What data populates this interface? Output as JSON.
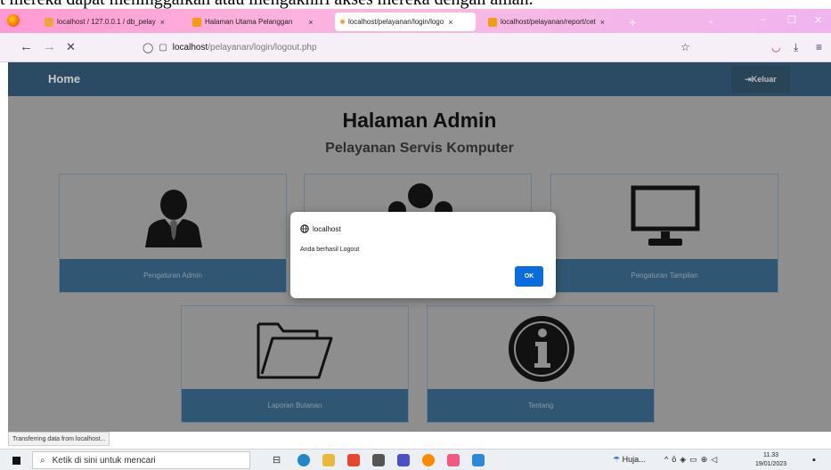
{
  "caption_text": "t mereka dapat meninggalkan atau mengakhiri akses mereka dengan aman.",
  "tabs": [
    {
      "label": "localhost / 127.0.0.1 / db_pelay",
      "active": false,
      "fav_color": "#f0a33a"
    },
    {
      "label": "Halaman Utama Pelanggan",
      "active": false,
      "fav_color": "#f39c12"
    },
    {
      "label": "localhost/pelayanan/login/logo",
      "active": true,
      "fav_color": "#f0a33a"
    },
    {
      "label": "localhost/pelayanan/report/cet",
      "active": false,
      "fav_color": "#f39c12"
    }
  ],
  "tab_close": "×",
  "new_tab": "+",
  "tab_menu": "⌄",
  "window_controls": {
    "minimize": "–",
    "restore": "❐",
    "close": "✕"
  },
  "nav": {
    "back": "←",
    "forward": "→",
    "stop": "✕",
    "url_host": "localhost",
    "url_path": "/pelayanan/login/logout.php",
    "bookmark_icon": "☆",
    "pocket_icon": "◡",
    "download_icon": "⤓",
    "menu_icon": "≡"
  },
  "site": {
    "home_label": "Home",
    "logout_label": "⇥Keluar",
    "title": "Halaman Admin",
    "subtitle": "Pelayanan Servis Komputer",
    "cards": [
      {
        "label": "Pengaturan Admin",
        "icon": "admin-user-icon"
      },
      {
        "label": "",
        "icon": "users-group-icon"
      },
      {
        "label": "Pengaturan Tampilan",
        "icon": "monitor-icon"
      },
      {
        "label": "Laporan Bulanan",
        "icon": "folder-icon"
      },
      {
        "label": "Tentang",
        "icon": "info-icon"
      }
    ]
  },
  "dialog": {
    "origin": "localhost",
    "message": "Anda berhasil Logout",
    "ok_label": "OK"
  },
  "status_text": "Transferring data from localhost...",
  "taskbar": {
    "search_placeholder": "Ketik di sini untuk mencari",
    "weather": "Huja...",
    "time": "11.33",
    "date": "19/01/2023"
  },
  "colors": {
    "accent_blue": "#0b6ce0",
    "site_nav": "#2a4b63",
    "card_caption": "#2f5773"
  }
}
